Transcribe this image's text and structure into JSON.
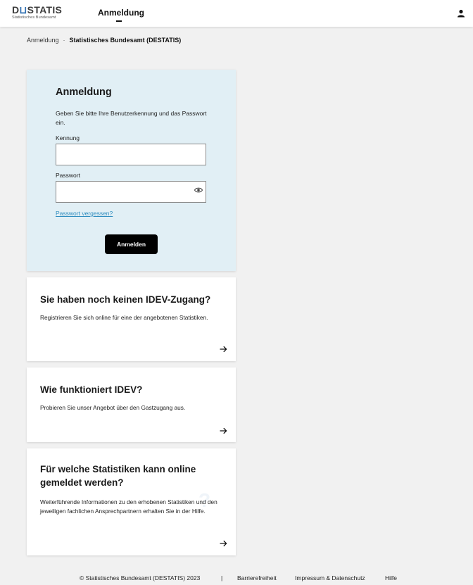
{
  "header": {
    "logo_main_prefix": "D",
    "logo_main_accent": "⊔",
    "logo_main_rest": "STATIS",
    "logo_sub": "Statistisches Bundesamt",
    "nav_title": "Anmeldung",
    "user_icon": "user-icon"
  },
  "breadcrumb": {
    "items": [
      "Anmeldung",
      "Statistisches Bundesamt (DESTATIS)"
    ],
    "separator": "·"
  },
  "login": {
    "title": "Anmeldung",
    "description": "Geben Sie bitte Ihre Benutzerkennung und das Passwort ein.",
    "username_label": "Kennung",
    "username_value": "",
    "password_label": "Passwort",
    "password_value": "",
    "forgot_link": "Passwort vergessen?",
    "submit_label": "Anmelden"
  },
  "cards": [
    {
      "title": "Sie haben noch keinen IDEV-Zugang?",
      "text": "Registrieren Sie sich online für eine der angebotenen Statistiken."
    },
    {
      "title": "Wie funktioniert IDEV?",
      "text": "Probieren Sie unser Angebot über den Gastzugang aus."
    },
    {
      "title": "Für welche Statistiken kann online gemeldet werden?",
      "text": "Weiterführende Informationen zu den erhobenen Statistiken und den jeweiligen fachlichen Ansprechpartnern erhalten Sie in der Hilfe.",
      "watermark": "?"
    }
  ],
  "footer": {
    "copyright": "©  Statistisches Bundesamt (DESTATIS) 2023",
    "divider": "|",
    "links": [
      "Barrierefreiheit",
      "Impressum & Datenschutz",
      "Hilfe"
    ]
  },
  "colors": {
    "login_card_bg": "#e1eff5",
    "link": "#2f8dbf",
    "button": "#000000",
    "page_bg": "#f1f1f1"
  }
}
